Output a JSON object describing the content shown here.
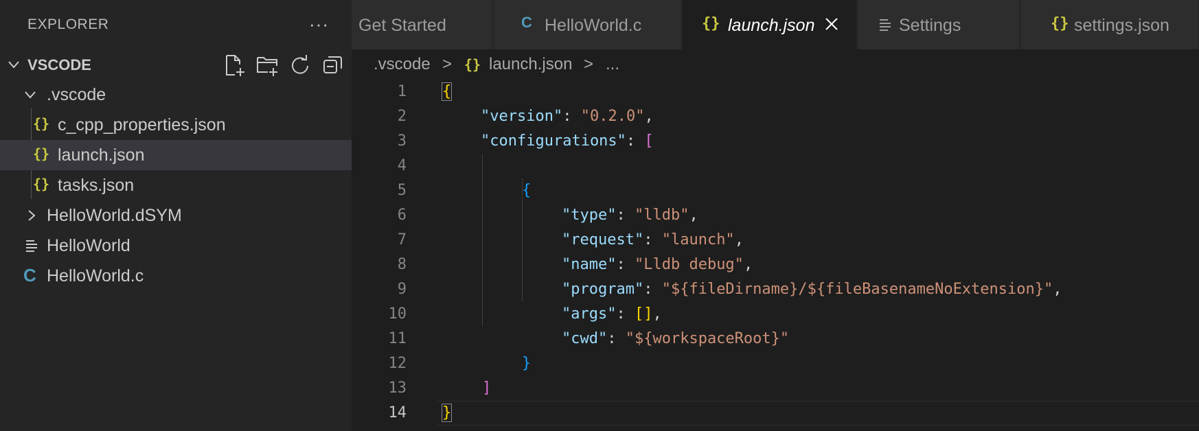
{
  "sidebar": {
    "title": "EXPLORER",
    "more_label": "···",
    "folder": {
      "name": "VSCODE",
      "expanded": true
    },
    "actions": [
      "new-file-icon",
      "new-folder-icon",
      "refresh-icon",
      "collapse-all-icon"
    ],
    "tree": [
      {
        "label": ".vscode",
        "kind": "folder",
        "expanded": true
      },
      {
        "label": "c_cpp_properties.json",
        "kind": "json"
      },
      {
        "label": "launch.json",
        "kind": "json",
        "selected": true
      },
      {
        "label": "tasks.json",
        "kind": "json"
      },
      {
        "label": "HelloWorld.dSYM",
        "kind": "folder",
        "expanded": false
      },
      {
        "label": "HelloWorld",
        "kind": "file"
      },
      {
        "label": "HelloWorld.c",
        "kind": "c"
      }
    ]
  },
  "tabs": [
    {
      "label": "Get Started",
      "icon": "none"
    },
    {
      "label": "HelloWorld.c",
      "icon": "c-file-icon",
      "icon_text": "C"
    },
    {
      "label": "launch.json",
      "icon": "json-file-icon",
      "icon_text": "{}",
      "active": true
    },
    {
      "label": "Settings",
      "icon": "settings-lines-icon"
    },
    {
      "label": "settings.json",
      "icon": "json-file-icon",
      "icon_text": "{}"
    }
  ],
  "breadcrumbs": {
    "folder": ".vscode",
    "sep": ">",
    "file_icon": "{}",
    "file": "launch.json",
    "tail": "..."
  },
  "editor": {
    "current_line": 14,
    "line_numbers": [
      "1",
      "2",
      "3",
      "4",
      "5",
      "6",
      "7",
      "8",
      "9",
      "10",
      "11",
      "12",
      "13",
      "14"
    ],
    "code": {
      "l1": "{",
      "l2_key": "\"version\"",
      "l2_val": "\"0.2.0\"",
      "l3_key": "\"configurations\"",
      "l3_br": "[",
      "l5": "{",
      "l6_key": "\"type\"",
      "l6_val": "\"lldb\"",
      "l7_key": "\"request\"",
      "l7_val": "\"launch\"",
      "l8_key": "\"name\"",
      "l8_val": "\"Lldb debug\"",
      "l9_key": "\"program\"",
      "l9_val": "\"${fileDirname}/${fileBasenameNoExtension}\"",
      "l10_key": "\"args\"",
      "l10_val": "[]",
      "l11_key": "\"cwd\"",
      "l11_val": "\"${workspaceRoot}\"",
      "l12": "}",
      "l13": "]",
      "l14": "}"
    },
    "punct": {
      "colon": ": ",
      "comma": ","
    }
  },
  "colors": {
    "key": "#9cdcfe",
    "string": "#ce9178",
    "bracket1": "#ffd700",
    "bracket2": "#da70d6",
    "bracket3": "#179fff",
    "json_icon": "#cbcb41",
    "c_icon": "#519aba"
  }
}
